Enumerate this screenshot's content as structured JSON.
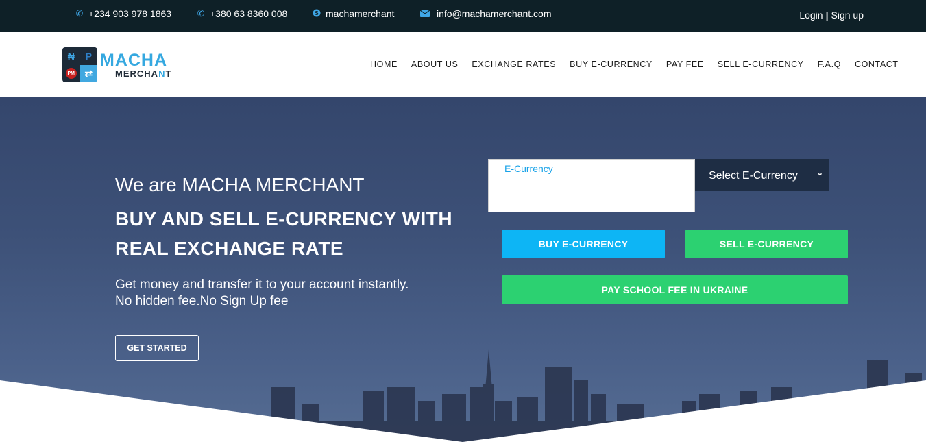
{
  "topbar": {
    "phone1": "+234 903 978 1863",
    "phone2": "+380 63 8360 008",
    "skype": "machamerchant",
    "email": "info@machamerchant.com",
    "login": "Login",
    "separator": "|",
    "signup": "Sign up",
    "icons": [
      "phone-icon",
      "phone-icon",
      "skype-icon",
      "envelope-icon"
    ],
    "icon_color": "#3fa6e5",
    "background": "#0e2027"
  },
  "logo": {
    "word1": "MACHA",
    "word2_a": "MERCHA",
    "word2_b": "N",
    "word2_c": "T",
    "tiles": [
      "₦",
      "P",
      "PM",
      "⇄"
    ]
  },
  "nav": {
    "items": [
      "HOME",
      "ABOUT US",
      "EXCHANGE RATES",
      "BUY E-CURRENCY",
      "PAY FEE",
      "SELL E-CURRENCY",
      "F.A.Q",
      "CONTACT"
    ]
  },
  "hero": {
    "intro": "We are MACHA MERCHANT",
    "title": "BUY AND SELL E-CURRENCY WITH REAL EXCHANGE RATE",
    "subtitle_line1": "Get money and transfer it to your account instantly.",
    "subtitle_line2": "No hidden fee.No Sign Up fee",
    "cta": "GET STARTED"
  },
  "exchange": {
    "amount_placeholder": "E-Currency",
    "select_value": "Select E-Currency",
    "buy_label": "BUY E-CURRENCY",
    "sell_label": "SELL E-CURRENCY",
    "fee_label": "PAY SCHOOL FEE IN UKRAINE",
    "colors": {
      "buy": "#0db5f5",
      "sell": "#2cd171",
      "select_bg": "#1e2d44"
    }
  }
}
